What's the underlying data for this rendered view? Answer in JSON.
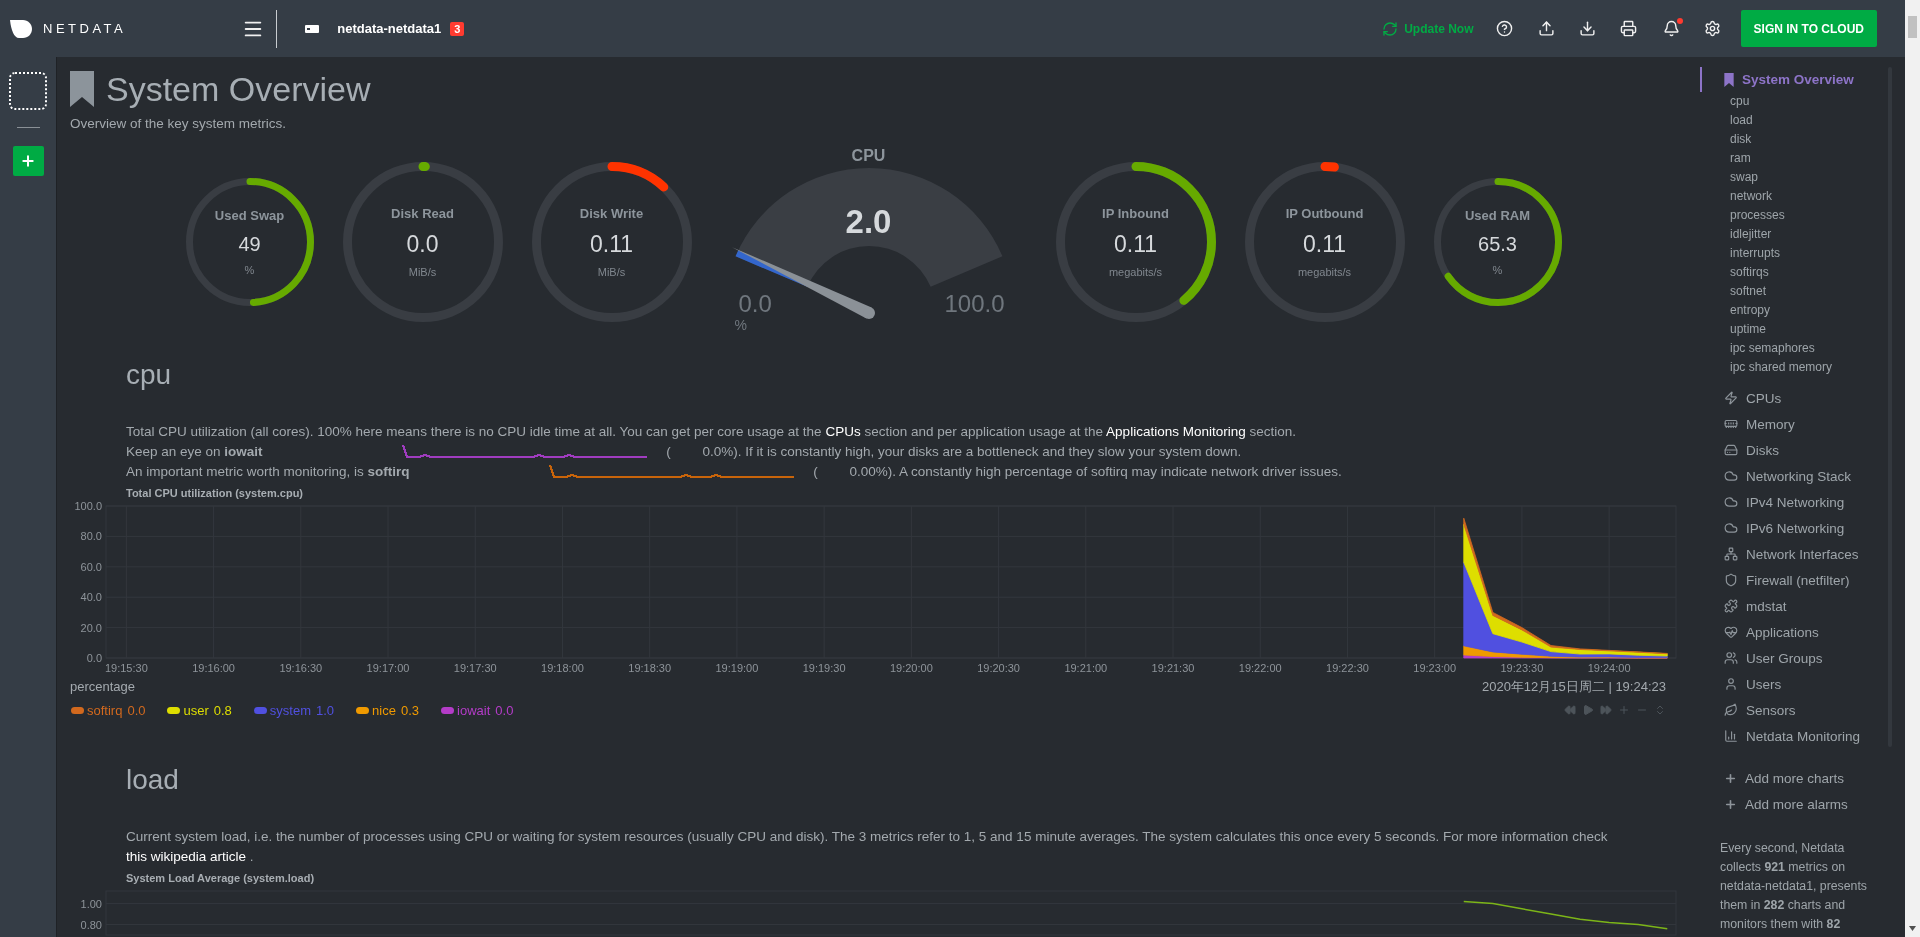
{
  "topbar": {
    "brand": "NETDATA",
    "host": "netdata-netdata1",
    "host_badge": "3",
    "update": "Update Now",
    "sign_in": "SIGN IN TO CLOUD",
    "alarm_dot": true
  },
  "page": {
    "title": "System Overview",
    "subtitle": "Overview of the key system metrics."
  },
  "gauges": [
    {
      "kind": "small",
      "title": "Used Swap",
      "value": "49",
      "unit": "%",
      "level": 0.49,
      "color": "#66aa00"
    },
    {
      "kind": "large",
      "title": "Disk Read",
      "value": "0.0",
      "unit": "MiB/s",
      "level": 0.005,
      "color": "#66aa00"
    },
    {
      "kind": "large",
      "title": "Disk Write",
      "value": "0.11",
      "unit": "MiB/s",
      "level": 0.12,
      "color": "#ff3300"
    },
    {
      "kind": "speedometer",
      "title": "CPU",
      "value": "2.0",
      "min": "0.0",
      "max": "100.0",
      "unit": "%",
      "level": 0.02
    },
    {
      "kind": "large",
      "title": "IP Inbound",
      "value": "0.11",
      "unit": "megabits/s",
      "level": 0.39,
      "color": "#66aa00"
    },
    {
      "kind": "large",
      "title": "IP Outbound",
      "value": "0.11",
      "unit": "megabits/s",
      "level": 0.02,
      "color": "#ff3300"
    },
    {
      "kind": "small",
      "title": "Used RAM",
      "value": "65.3",
      "unit": "%",
      "level": 0.653,
      "color": "#66aa00"
    }
  ],
  "sections": [
    {
      "heading": "cpu",
      "lines": [
        {
          "parts": [
            {
              "kind": "text",
              "text": "Total CPU utilization (all cores). 100% here means there is no CPU idle time at all. You can get per core usage at the"
            },
            {
              "kind": "link",
              "text": "CPUs"
            },
            {
              "kind": "text",
              "text": "section and per application usage at the"
            },
            {
              "kind": "link",
              "text": "Applications Monitoring"
            },
            {
              "kind": "text",
              "text": "section."
            }
          ]
        },
        {
          "parts": [
            {
              "kind": "text",
              "text": "Keep an eye on **iowait**"
            },
            {
              "kind": "sparkline",
              "color": "#a03cc0"
            },
            {
              "kind": "paren",
              "text": "("
            },
            {
              "kind": "text",
              "text": "0.0%). If it is constantly high, your disks are a bottleneck and they slow your system down."
            }
          ]
        },
        {
          "parts": [
            {
              "kind": "text",
              "text": "An important metric worth monitoring, is **softirq**"
            },
            {
              "kind": "sparkline",
              "color": "#c8640a"
            },
            {
              "kind": "paren",
              "text": "("
            },
            {
              "kind": "text",
              "text": "0.00%). A constantly high percentage of softirq may indicate network driver issues."
            }
          ]
        }
      ],
      "timestamp": "2020年12月15日周二 | 19:24:23",
      "legend_values": [
        "0.0",
        "0.8",
        "1.0",
        "0.3",
        "0.0"
      ],
      "chart_data": {
        "type": "area",
        "stacked": true,
        "title": "Total CPU utilization (system.cpu)",
        "ylabel": "percentage",
        "categories": [
          "19:15:30",
          null,
          null,
          "19:16:00",
          null,
          null,
          "19:16:30",
          null,
          null,
          "19:17:00",
          null,
          null,
          "19:17:30",
          null,
          null,
          "19:18:00",
          null,
          null,
          "19:18:30",
          null,
          null,
          "19:19:00",
          null,
          null,
          "19:19:30",
          null,
          null,
          "19:20:00",
          null,
          null,
          "19:20:30",
          null,
          null,
          "19:21:00",
          null,
          null,
          "19:21:30",
          null,
          null,
          "19:22:00",
          null,
          null,
          "19:22:30",
          null,
          null,
          "19:23:00",
          null,
          null,
          "19:23:30",
          null,
          null,
          "19:24:00",
          null,
          null
        ],
        "grid": true,
        "ylim": [
          0,
          100
        ],
        "yticks": [
          {
            "value": 0,
            "label": "0.0"
          },
          {
            "value": 20,
            "label": "20.0"
          },
          {
            "value": 40,
            "label": "40.0"
          },
          {
            "value": 60,
            "label": "60.0"
          },
          {
            "value": 80,
            "label": "80.0"
          },
          {
            "value": 100,
            "label": "100.0"
          }
        ],
        "series": [
          {
            "name": "softirq",
            "color": "#d2691e",
            "values": [
              null,
              null,
              null,
              null,
              null,
              null,
              null,
              null,
              null,
              null,
              null,
              null,
              null,
              null,
              null,
              null,
              null,
              null,
              null,
              null,
              null,
              null,
              null,
              null,
              null,
              null,
              null,
              null,
              null,
              null,
              null,
              null,
              null,
              null,
              null,
              null,
              null,
              null,
              null,
              null,
              null,
              null,
              null,
              null,
              null,
              null,
              4,
              2,
              1.5,
              1,
              0.4,
              0.3,
              0.2,
              0.2
            ]
          },
          {
            "name": "user",
            "color": "#dede00",
            "values": [
              null,
              null,
              null,
              null,
              null,
              null,
              null,
              null,
              null,
              null,
              null,
              null,
              null,
              null,
              null,
              null,
              null,
              null,
              null,
              null,
              null,
              null,
              null,
              null,
              null,
              null,
              null,
              null,
              null,
              null,
              null,
              null,
              null,
              null,
              null,
              null,
              null,
              null,
              null,
              null,
              null,
              null,
              null,
              null,
              null,
              null,
              25,
              12,
              8,
              3,
              3,
              2,
              2,
              1.5
            ]
          },
          {
            "name": "system",
            "color": "#5050e0",
            "values": [
              null,
              null,
              null,
              null,
              null,
              null,
              null,
              null,
              null,
              null,
              null,
              null,
              null,
              null,
              null,
              null,
              null,
              null,
              null,
              null,
              null,
              null,
              null,
              null,
              null,
              null,
              null,
              null,
              null,
              null,
              null,
              null,
              null,
              null,
              null,
              null,
              null,
              null,
              null,
              null,
              null,
              null,
              null,
              null,
              null,
              null,
              55,
              12,
              8,
              3,
              2,
              2,
              1.5,
              1
            ]
          },
          {
            "name": "nice",
            "color": "#f09a00",
            "values": [
              null,
              null,
              null,
              null,
              null,
              null,
              null,
              null,
              null,
              null,
              null,
              null,
              null,
              null,
              null,
              null,
              null,
              null,
              null,
              null,
              null,
              null,
              null,
              null,
              null,
              null,
              null,
              null,
              null,
              null,
              null,
              null,
              null,
              null,
              null,
              null,
              null,
              null,
              null,
              null,
              null,
              null,
              null,
              null,
              null,
              null,
              6,
              3,
              2,
              1,
              0.5,
              0.5,
              0.3,
              0.3
            ]
          },
          {
            "name": "iowait",
            "color": "#b43cc8",
            "values": [
              null,
              null,
              null,
              null,
              null,
              null,
              null,
              null,
              null,
              null,
              null,
              null,
              null,
              null,
              null,
              null,
              null,
              null,
              null,
              null,
              null,
              null,
              null,
              null,
              null,
              null,
              null,
              null,
              null,
              null,
              null,
              null,
              null,
              null,
              null,
              null,
              null,
              null,
              null,
              null,
              null,
              null,
              null,
              null,
              null,
              null,
              2,
              1,
              0.5,
              0.2,
              0.1,
              0.2,
              0,
              0
            ]
          }
        ]
      }
    },
    {
      "heading": "load",
      "lines": [
        {
          "parts": [
            {
              "kind": "text",
              "text": "Current system load, i.e. the number of processes using CPU or waiting for system resources (usually CPU and disk). The 3 metrics refer to 1, 5 and 15 minute averages. The system calculates this once every 5 seconds. For more information check"
            },
            {
              "kind": "link",
              "text": "this wikipedia article"
            },
            {
              "kind": "text",
              "text": "."
            }
          ]
        }
      ],
      "chart_data": {
        "type": "line",
        "title": "System Load Average (system.load)",
        "categories": [
          null,
          null,
          null,
          null,
          null,
          null,
          null,
          null,
          null,
          null,
          null,
          null,
          null,
          null,
          null,
          null,
          null,
          null,
          null,
          null,
          null,
          null,
          null,
          null,
          null,
          null,
          null,
          null,
          null,
          null,
          null,
          null,
          null,
          null,
          null,
          null,
          null,
          null,
          null,
          null,
          null,
          null,
          null,
          null,
          null,
          null,
          null,
          null,
          null,
          null,
          null,
          null,
          null,
          null
        ],
        "grid": true,
        "ylim": [
          0.7,
          1.12
        ],
        "yticks": [
          {
            "value": 0.8,
            "label": "0.80"
          },
          {
            "value": 1,
            "label": "1.00"
          }
        ],
        "series": [
          {
            "color": "#7cb518",
            "values": [
              null,
              null,
              null,
              null,
              null,
              null,
              null,
              null,
              null,
              null,
              null,
              null,
              null,
              null,
              null,
              null,
              null,
              null,
              null,
              null,
              null,
              null,
              null,
              null,
              null,
              null,
              null,
              null,
              null,
              null,
              null,
              null,
              null,
              null,
              null,
              null,
              null,
              null,
              null,
              null,
              null,
              null,
              null,
              null,
              null,
              null,
              1.02,
              1.0,
              0.95,
              0.9,
              0.85,
              0.82,
              0.8,
              0.76
            ]
          }
        ]
      }
    }
  ],
  "sidebar": {
    "items": [
      {
        "label": "System Overview",
        "selected": true,
        "children": [
          {
            "label": "cpu",
            "selected": false
          },
          {
            "label": "load",
            "selected": false
          },
          {
            "label": "disk",
            "selected": false
          },
          {
            "label": "ram",
            "selected": false
          },
          {
            "label": "swap",
            "selected": false
          },
          {
            "label": "network",
            "selected": false
          },
          {
            "label": "processes",
            "selected": false
          },
          {
            "label": "idlejitter",
            "selected": false
          },
          {
            "label": "interrupts",
            "selected": false
          },
          {
            "label": "softirqs",
            "selected": false
          },
          {
            "label": "softnet",
            "selected": false
          },
          {
            "label": "entropy",
            "selected": false
          },
          {
            "label": "uptime",
            "selected": false
          },
          {
            "label": "ipc semaphores",
            "selected": false
          },
          {
            "label": "ipc shared memory",
            "selected": false
          }
        ]
      },
      {
        "label": "CPUs",
        "selected": false
      },
      {
        "label": "Memory",
        "selected": false
      },
      {
        "label": "Disks",
        "selected": false
      },
      {
        "label": "Networking Stack",
        "selected": false
      },
      {
        "label": "IPv4 Networking",
        "selected": false
      },
      {
        "label": "IPv6 Networking",
        "selected": false
      },
      {
        "label": "Network Interfaces",
        "selected": false
      },
      {
        "label": "Firewall (netfilter)",
        "selected": false
      },
      {
        "label": "mdstat",
        "selected": false
      },
      {
        "label": "Applications",
        "selected": false
      },
      {
        "label": "User Groups",
        "selected": false
      },
      {
        "label": "Users",
        "selected": false
      },
      {
        "label": "Sensors",
        "selected": false
      },
      {
        "label": "Netdata Monitoring",
        "selected": false
      }
    ],
    "actions": [
      {
        "label": "Add more charts"
      },
      {
        "label": "Add more alarms"
      }
    ],
    "footer": "Every second, Netdata collects **921** metrics on netdata-netdata1, presents them in **282** charts and monitors them with **82**"
  }
}
